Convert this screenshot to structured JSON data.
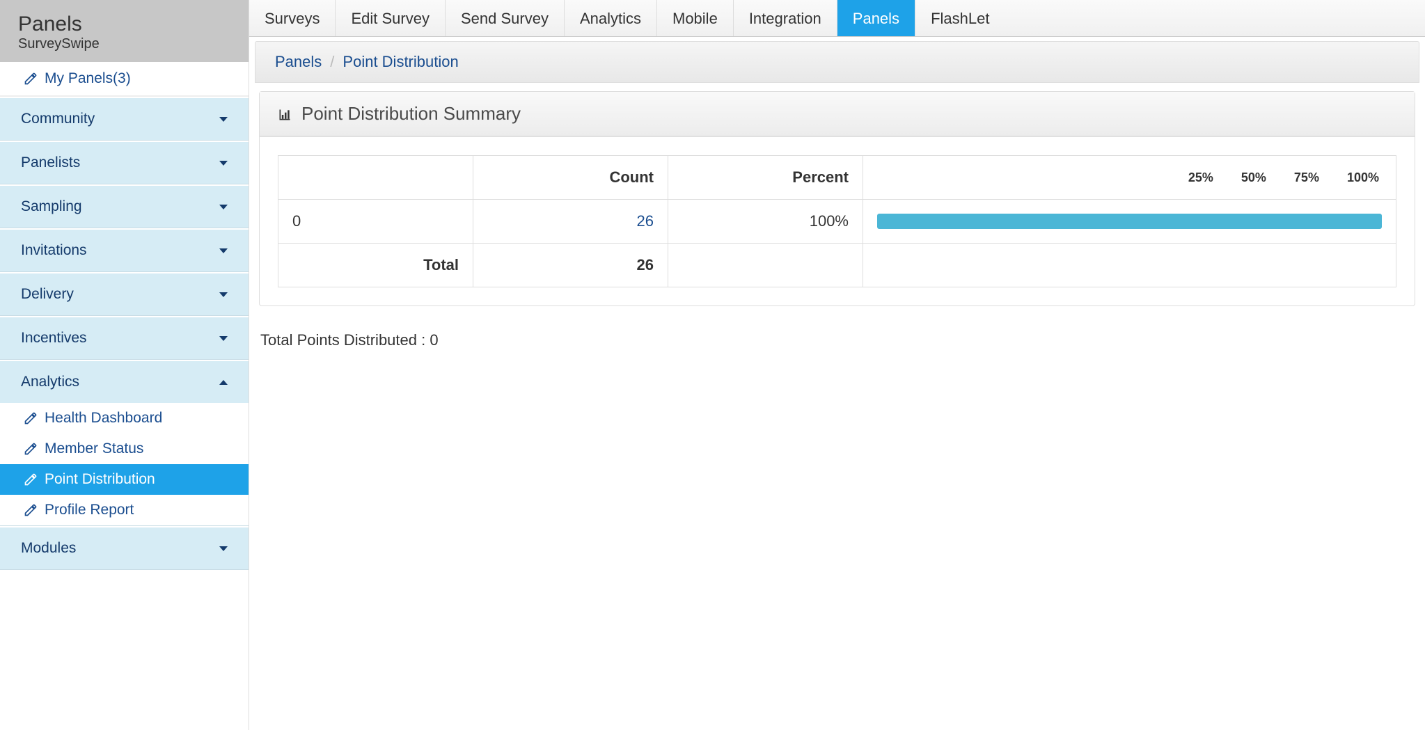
{
  "sidebar": {
    "title": "Panels",
    "subtitle": "SurveySwipe",
    "my_panels_label": "My Panels(3)",
    "sections": [
      {
        "label": "Community",
        "expanded": false
      },
      {
        "label": "Panelists",
        "expanded": false
      },
      {
        "label": "Sampling",
        "expanded": false
      },
      {
        "label": "Invitations",
        "expanded": false
      },
      {
        "label": "Delivery",
        "expanded": false
      },
      {
        "label": "Incentives",
        "expanded": false
      },
      {
        "label": "Analytics",
        "expanded": true,
        "items": [
          {
            "label": "Health Dashboard",
            "active": false
          },
          {
            "label": "Member Status",
            "active": false
          },
          {
            "label": "Point Distribution",
            "active": true
          },
          {
            "label": "Profile Report",
            "active": false
          }
        ]
      },
      {
        "label": "Modules",
        "expanded": false
      }
    ]
  },
  "topnav": [
    {
      "label": "Surveys"
    },
    {
      "label": "Edit Survey"
    },
    {
      "label": "Send Survey"
    },
    {
      "label": "Analytics"
    },
    {
      "label": "Mobile"
    },
    {
      "label": "Integration"
    },
    {
      "label": "Panels",
      "active": true
    },
    {
      "label": "FlashLet"
    }
  ],
  "breadcrumb": {
    "root": "Panels",
    "current": "Point Distribution"
  },
  "panel": {
    "title": "Point Distribution Summary",
    "headers": {
      "count": "Count",
      "percent": "Percent",
      "pct_ticks": [
        "25%",
        "50%",
        "75%",
        "100%"
      ]
    },
    "rows": [
      {
        "label": "0",
        "count": "26",
        "percent": "100%",
        "bar_pct": 100
      }
    ],
    "total_label": "Total",
    "total_count": "26"
  },
  "footer_note": "Total Points Distributed : 0",
  "chart_data": {
    "type": "bar",
    "categories": [
      "0"
    ],
    "values": [
      100
    ],
    "xlabel": "",
    "ylabel": "Percent",
    "ylim": [
      0,
      100
    ],
    "title": "Point Distribution Summary"
  }
}
